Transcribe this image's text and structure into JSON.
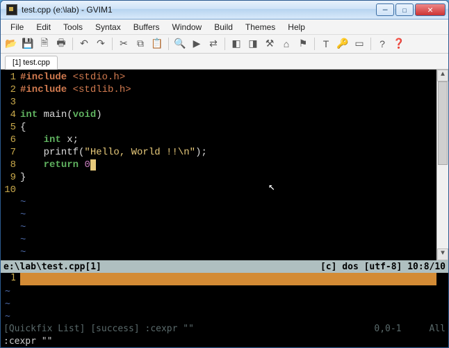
{
  "window": {
    "title": "test.cpp (e:\\lab) - GVIM1"
  },
  "menu": {
    "items": [
      "File",
      "Edit",
      "Tools",
      "Syntax",
      "Buffers",
      "Window",
      "Build",
      "Themes",
      "Help"
    ]
  },
  "toolbar": {
    "icons": [
      {
        "name": "open-icon",
        "glyph": "📂"
      },
      {
        "name": "save-icon",
        "glyph": "💾"
      },
      {
        "name": "saveall-icon",
        "glyph": "🗎"
      },
      {
        "name": "print-icon",
        "glyph": "🖶"
      },
      {
        "sep": true
      },
      {
        "name": "undo-icon",
        "glyph": "↶"
      },
      {
        "name": "redo-icon",
        "glyph": "↷"
      },
      {
        "sep": true
      },
      {
        "name": "cut-icon",
        "glyph": "✂"
      },
      {
        "name": "copy-icon",
        "glyph": "⧉"
      },
      {
        "name": "paste-icon",
        "glyph": "📋"
      },
      {
        "sep": true
      },
      {
        "name": "find-icon",
        "glyph": "🔍"
      },
      {
        "name": "findnext-icon",
        "glyph": "▶"
      },
      {
        "name": "replace-icon",
        "glyph": "⇄"
      },
      {
        "sep": true
      },
      {
        "name": "session-icon",
        "glyph": "◧"
      },
      {
        "name": "script-icon",
        "glyph": "◨"
      },
      {
        "name": "make-icon",
        "glyph": "⚒"
      },
      {
        "name": "shell-icon",
        "glyph": "⌂"
      },
      {
        "name": "tags-icon",
        "glyph": "⚑"
      },
      {
        "sep": true
      },
      {
        "name": "tool1-icon",
        "glyph": "T"
      },
      {
        "name": "tool2-icon",
        "glyph": "🔑"
      },
      {
        "name": "tool3-icon",
        "glyph": "▭"
      },
      {
        "sep": true
      },
      {
        "name": "help-icon",
        "glyph": "?"
      },
      {
        "name": "search-help-icon",
        "glyph": "❓"
      }
    ]
  },
  "tabs": {
    "items": [
      {
        "label": "[1] test.cpp"
      }
    ]
  },
  "code": {
    "lines": [
      {
        "n": "1",
        "html": "<span class='pp'>#include</span> <span class='inc'>&lt;stdio.h&gt;</span>"
      },
      {
        "n": "2",
        "html": "<span class='pp'>#include</span> <span class='inc'>&lt;stdlib.h&gt;</span>"
      },
      {
        "n": "3",
        "html": ""
      },
      {
        "n": "4",
        "html": "<span class='type'>int</span> main(<span class='type'>void</span>)"
      },
      {
        "n": "5",
        "html": "{"
      },
      {
        "n": "6",
        "html": "    <span class='type'>int</span> x;"
      },
      {
        "n": "7",
        "html": "    printf(<span class='str'>\"Hello, World !!</span><span class='str'>\\n</span><span class='str'>\"</span>);"
      },
      {
        "n": "8",
        "html": "    <span class='kw'>return</span> <span class='num'>0</span><span class='cursorblk'></span>"
      },
      {
        "n": "9",
        "html": "}"
      },
      {
        "n": "10",
        "html": ""
      }
    ],
    "tildes": 5
  },
  "status": {
    "left": "e:\\lab\\test.cpp[1]",
    "right": "[c] dos [utf-8] 10:8/10"
  },
  "quickfix": {
    "line_no": "1",
    "tildes": 3,
    "status_left": "[Quickfix List] [success]  :cexpr \"\"",
    "status_mid": "0,0-1",
    "status_right": "All"
  },
  "cmdline": ":cexpr \"\""
}
